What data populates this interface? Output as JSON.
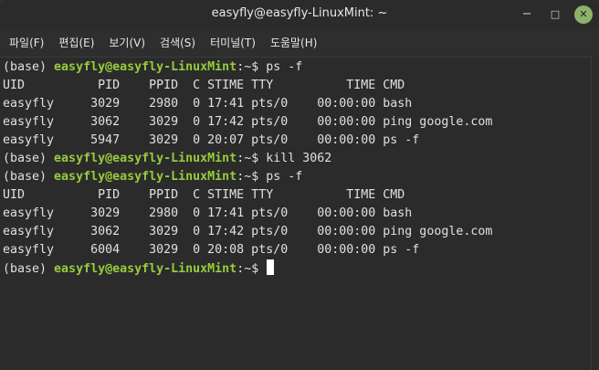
{
  "window": {
    "title": "easyfly@easyfly-LinuxMint: ~",
    "controls": {
      "minimize": "−",
      "maximize": "□",
      "close": "✕"
    }
  },
  "menu": [
    {
      "label": "파일(F)"
    },
    {
      "label": "편집(E)"
    },
    {
      "label": "보기(V)"
    },
    {
      "label": "검색(S)"
    },
    {
      "label": "터미널(T)"
    },
    {
      "label": "도움말(H)"
    }
  ],
  "colors": {
    "prompt_user": "#97cc3c",
    "close_button": "#8fb26b",
    "background": "#2b2b2b",
    "text": "#e0e0e0"
  },
  "terminal": {
    "lines": [
      {
        "kind": "prompt",
        "env": "(base) ",
        "user": "easyfly@easyfly-LinuxMint",
        "sep": ":~$ ",
        "cmd": "ps -f"
      },
      {
        "kind": "output",
        "text": "UID          PID    PPID  C STIME TTY          TIME CMD"
      },
      {
        "kind": "output",
        "text": "easyfly     3029    2980  0 17:41 pts/0    00:00:00 bash"
      },
      {
        "kind": "output",
        "text": "easyfly     3062    3029  0 17:42 pts/0    00:00:00 ping google.com"
      },
      {
        "kind": "output",
        "text": "easyfly     5947    3029  0 20:07 pts/0    00:00:00 ps -f"
      },
      {
        "kind": "prompt",
        "env": "(base) ",
        "user": "easyfly@easyfly-LinuxMint",
        "sep": ":~$ ",
        "cmd": "kill 3062"
      },
      {
        "kind": "prompt",
        "env": "(base) ",
        "user": "easyfly@easyfly-LinuxMint",
        "sep": ":~$ ",
        "cmd": "ps -f"
      },
      {
        "kind": "output",
        "text": "UID          PID    PPID  C STIME TTY          TIME CMD"
      },
      {
        "kind": "output",
        "text": "easyfly     3029    2980  0 17:41 pts/0    00:00:00 bash"
      },
      {
        "kind": "output",
        "text": "easyfly     3062    3029  0 17:42 pts/0    00:00:00 ping google.com"
      },
      {
        "kind": "output",
        "text": "easyfly     6004    3029  0 20:08 pts/0    00:00:00 ps -f"
      },
      {
        "kind": "prompt",
        "env": "(base) ",
        "user": "easyfly@easyfly-LinuxMint",
        "sep": ":~$ ",
        "cmd": "",
        "cursor": true
      }
    ]
  }
}
